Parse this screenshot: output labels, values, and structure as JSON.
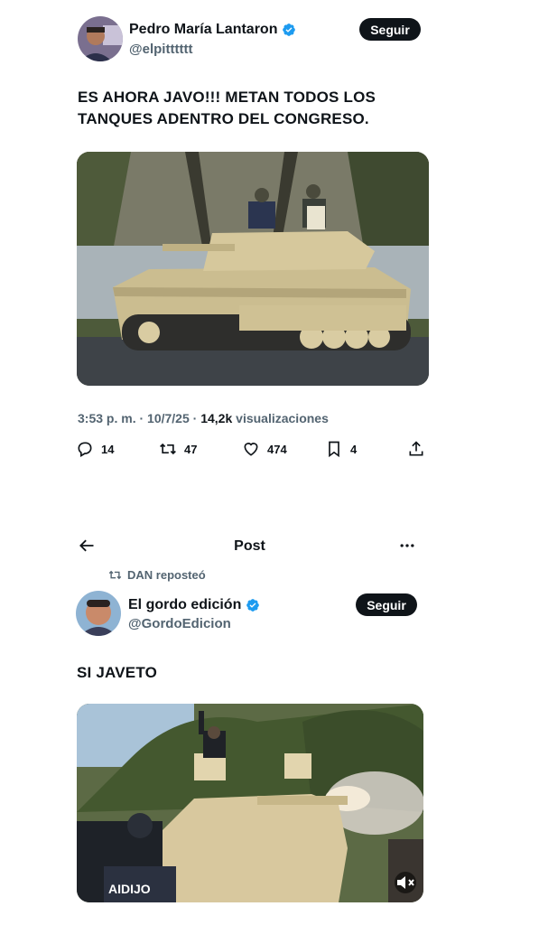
{
  "tweet1": {
    "display_name": "Pedro María Lantaron",
    "handle": "@elpitttttt",
    "follow_label": "Seguir",
    "text_line1": "ES AHORA JAVO!!! METAN TODOS LOS",
    "text_line2": "TANQUES ADENTRO DEL CONGRESO.",
    "time": "3:53 p. m.",
    "date": "10/7/25",
    "views_count": "14,2k",
    "views_label": "visualizaciones",
    "replies": "14",
    "reposts": "47",
    "likes": "474",
    "bookmarks": "4"
  },
  "post_header": {
    "title": "Post"
  },
  "tweet2": {
    "repost_label": "DAN reposteó",
    "display_name": "El gordo edición",
    "handle": "@GordoEdicion",
    "follow_label": "Seguir",
    "text": "SI JAVETO",
    "vest_text": "AIDIJO"
  },
  "colors": {
    "text": "#0f1419",
    "secondary": "#536471",
    "verified": "#1d9bf0",
    "button_bg": "#0f1419"
  },
  "icons": [
    "verified-icon",
    "reply-icon",
    "repost-icon",
    "like-icon",
    "bookmark-icon",
    "share-icon",
    "back-arrow-icon",
    "more-icon",
    "volume-icon"
  ]
}
